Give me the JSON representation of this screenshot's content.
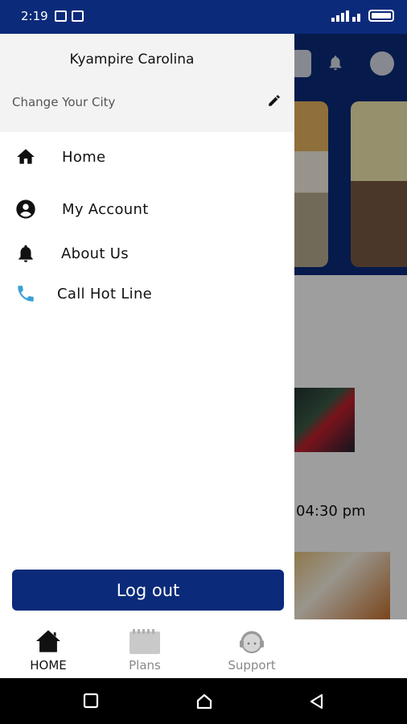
{
  "status_bar": {
    "time": "2:19"
  },
  "background": {
    "event_time": "04:30 pm"
  },
  "drawer": {
    "user_name": "Kyampire Carolina",
    "change_city": "Change Your City",
    "menu": [
      {
        "label": "Home",
        "icon": "home-icon"
      },
      {
        "label": "My Account",
        "icon": "account-icon"
      },
      {
        "label": "About Us",
        "icon": "bell-icon"
      },
      {
        "label": "Call Hot Line",
        "icon": "phone-icon"
      }
    ],
    "logout_label": "Log out"
  },
  "tabs": [
    {
      "label": "HOME",
      "icon": "home-icon"
    },
    {
      "label": "Plans",
      "icon": "calendar-icon"
    },
    {
      "label": "Support",
      "icon": "support-agent-icon"
    }
  ],
  "colors": {
    "primary": "#0b2a7a",
    "accent_phone": "#3aa0d8"
  }
}
